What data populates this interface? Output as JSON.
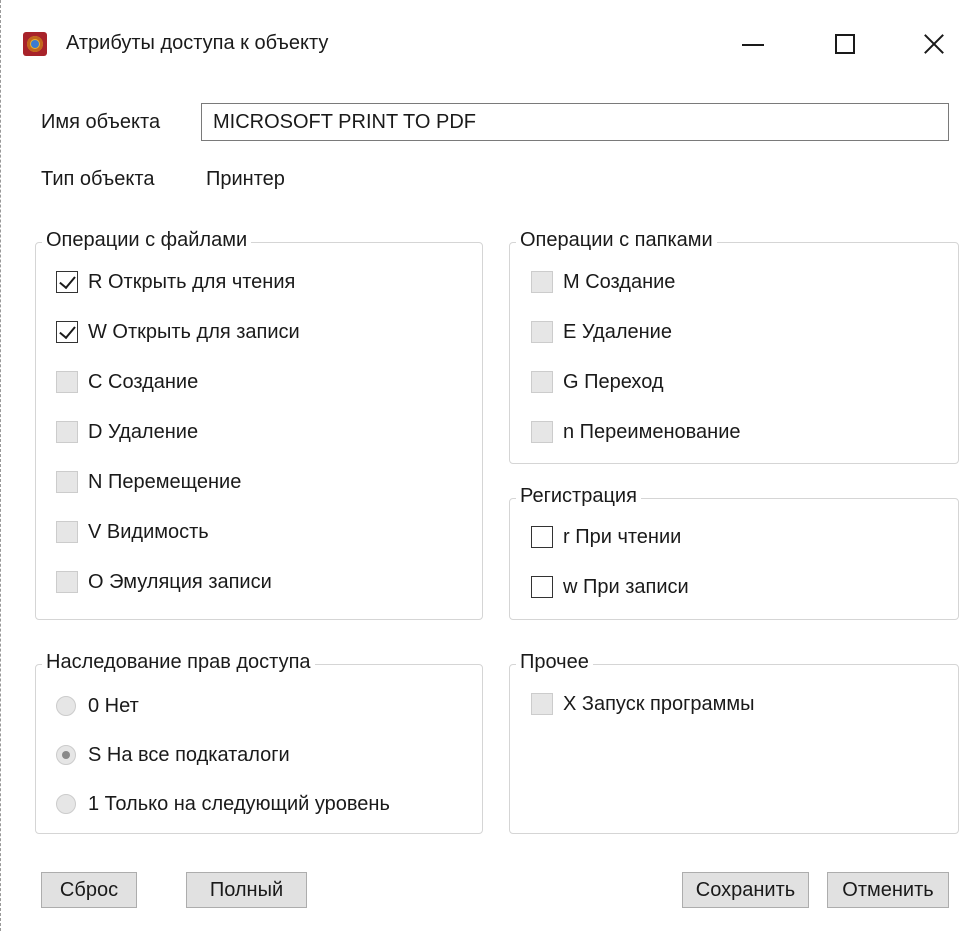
{
  "window": {
    "title": "Атрибуты доступа к объекту"
  },
  "object": {
    "name_label": "Имя объекта",
    "name_value": "MICROSOFT PRINT TO PDF",
    "type_label": "Тип объекта",
    "type_value": "Принтер"
  },
  "file_ops": {
    "title": "Операции с файлами",
    "items": [
      {
        "label": "R Открыть для чтения",
        "checked": true,
        "enabled": true
      },
      {
        "label": "W Открыть для записи",
        "checked": true,
        "enabled": true
      },
      {
        "label": "C Создание",
        "checked": false,
        "enabled": false
      },
      {
        "label": "D Удаление",
        "checked": false,
        "enabled": false
      },
      {
        "label": "N Перемещение",
        "checked": false,
        "enabled": false
      },
      {
        "label": "V Видимость",
        "checked": false,
        "enabled": false
      },
      {
        "label": "O Эмуляция записи",
        "checked": false,
        "enabled": false
      }
    ]
  },
  "folder_ops": {
    "title": "Операции с папками",
    "items": [
      {
        "label": "M Создание",
        "checked": false,
        "enabled": false
      },
      {
        "label": "E Удаление",
        "checked": false,
        "enabled": false
      },
      {
        "label": "G Переход",
        "checked": false,
        "enabled": false
      },
      {
        "label": "n Переименование",
        "checked": false,
        "enabled": false
      }
    ]
  },
  "registration": {
    "title": "Регистрация",
    "items": [
      {
        "label": "r При чтении",
        "checked": false,
        "enabled": true
      },
      {
        "label": "w При записи",
        "checked": false,
        "enabled": true
      }
    ]
  },
  "inheritance": {
    "title": "Наследование прав доступа",
    "options": [
      {
        "label": "0 Нет",
        "selected": false,
        "enabled": false
      },
      {
        "label": "S На все подкаталоги",
        "selected": true,
        "enabled": false
      },
      {
        "label": "1 Только на следующий уровень",
        "selected": false,
        "enabled": false
      }
    ]
  },
  "other": {
    "title": "Прочее",
    "items": [
      {
        "label": "X Запуск программы",
        "checked": false,
        "enabled": false
      }
    ]
  },
  "buttons": {
    "reset": "Сброс",
    "full": "Полный",
    "save": "Сохранить",
    "cancel": "Отменить"
  }
}
